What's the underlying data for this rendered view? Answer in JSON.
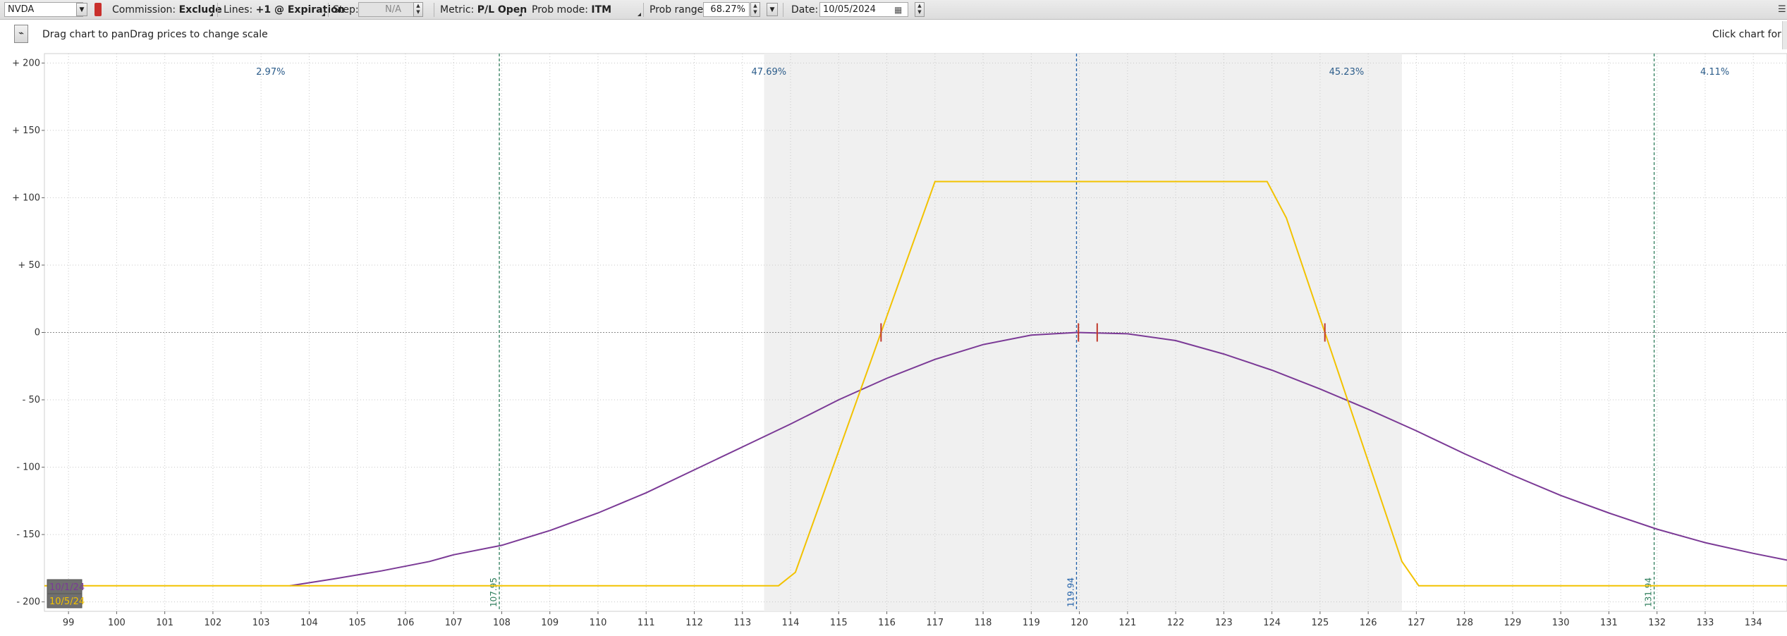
{
  "toolbar": {
    "symbol": "NVDA",
    "commission_label": "Commission:",
    "commission_value": "Exclude",
    "lines_label": "Lines:",
    "lines_value": "+1 @ Expiration",
    "step_label": "Step:",
    "step_value": "N/A",
    "metric_label": "Metric:",
    "metric_value": "P/L Open",
    "prob_mode_label": "Prob mode:",
    "prob_mode_value": "ITM",
    "prob_range_label": "Prob range:",
    "prob_range_value": "68.27%",
    "date_label": "Date:",
    "date_value": "10/05/2024"
  },
  "hints": {
    "left": "Drag chart to panDrag prices to change scale",
    "right": "Click chart for data"
  },
  "chart_data": {
    "type": "line",
    "xlim": [
      98.5,
      134.7
    ],
    "ylim": [
      -207,
      207
    ],
    "x_ticks": [
      "99",
      "100",
      "101",
      "102",
      "103",
      "104",
      "105",
      "106",
      "107",
      "108",
      "109",
      "110",
      "111",
      "112",
      "113",
      "114",
      "115",
      "116",
      "117",
      "118",
      "119",
      "120",
      "121",
      "122",
      "123",
      "124",
      "125",
      "126",
      "127",
      "128",
      "129",
      "130",
      "131",
      "132",
      "133",
      "134"
    ],
    "y_ticks": [
      {
        "value": 200,
        "label": "+ 200"
      },
      {
        "value": 150,
        "label": "+ 150"
      },
      {
        "value": 100,
        "label": "+ 100"
      },
      {
        "value": 50,
        "label": "+ 50"
      },
      {
        "value": 0,
        "label": "0"
      },
      {
        "value": -50,
        "label": "- 50"
      },
      {
        "value": -100,
        "label": "- 100"
      },
      {
        "value": -150,
        "label": "- 150"
      },
      {
        "value": -200,
        "label": "- 200"
      }
    ],
    "shaded_range": [
      113.45,
      126.7
    ],
    "prob_labels": [
      {
        "x": 103.2,
        "text": "2.97%"
      },
      {
        "x": 113.55,
        "text": "47.69%"
      },
      {
        "x": 125.55,
        "text": "45.23%"
      },
      {
        "x": 133.2,
        "text": "4.11%"
      }
    ],
    "vlines": [
      {
        "x": 107.95,
        "label": "107.95",
        "color": "#2e7d5b"
      },
      {
        "x": 119.94,
        "label": "119.94",
        "color": "#1f5fa8"
      },
      {
        "x": 131.94,
        "label": "131.94",
        "color": "#2e7d5b"
      }
    ],
    "breakeven_marks": [
      115.88,
      119.98,
      120.37,
      125.1
    ],
    "series": [
      {
        "name": "10/1/24",
        "color": "#7b3a96",
        "points": [
          [
            103.6,
            -188
          ],
          [
            104.5,
            -183
          ],
          [
            105.5,
            -177
          ],
          [
            106.5,
            -170
          ],
          [
            107,
            -165
          ],
          [
            108,
            -158
          ],
          [
            109,
            -147
          ],
          [
            110,
            -134
          ],
          [
            111,
            -119
          ],
          [
            112,
            -102
          ],
          [
            113,
            -85
          ],
          [
            114,
            -68
          ],
          [
            115,
            -50
          ],
          [
            116,
            -34
          ],
          [
            117,
            -20
          ],
          [
            118,
            -9
          ],
          [
            119,
            -2
          ],
          [
            119.94,
            0
          ],
          [
            121,
            -1
          ],
          [
            122,
            -6
          ],
          [
            123,
            -16
          ],
          [
            124,
            -28
          ],
          [
            125,
            -42
          ],
          [
            126,
            -57
          ],
          [
            127,
            -73
          ],
          [
            128,
            -90
          ],
          [
            129,
            -106
          ],
          [
            130,
            -121
          ],
          [
            131,
            -134
          ],
          [
            132,
            -146
          ],
          [
            133,
            -156
          ],
          [
            134,
            -164
          ],
          [
            134.7,
            -169
          ]
        ]
      },
      {
        "name": "10/5/24",
        "color": "#f2c200",
        "points": [
          [
            98.5,
            -188
          ],
          [
            113.75,
            -188
          ],
          [
            114.1,
            -178
          ],
          [
            117,
            112
          ],
          [
            123.9,
            112
          ],
          [
            124.3,
            85
          ],
          [
            126.7,
            -170
          ],
          [
            127.05,
            -188
          ],
          [
            134.7,
            -188
          ]
        ]
      }
    ]
  }
}
